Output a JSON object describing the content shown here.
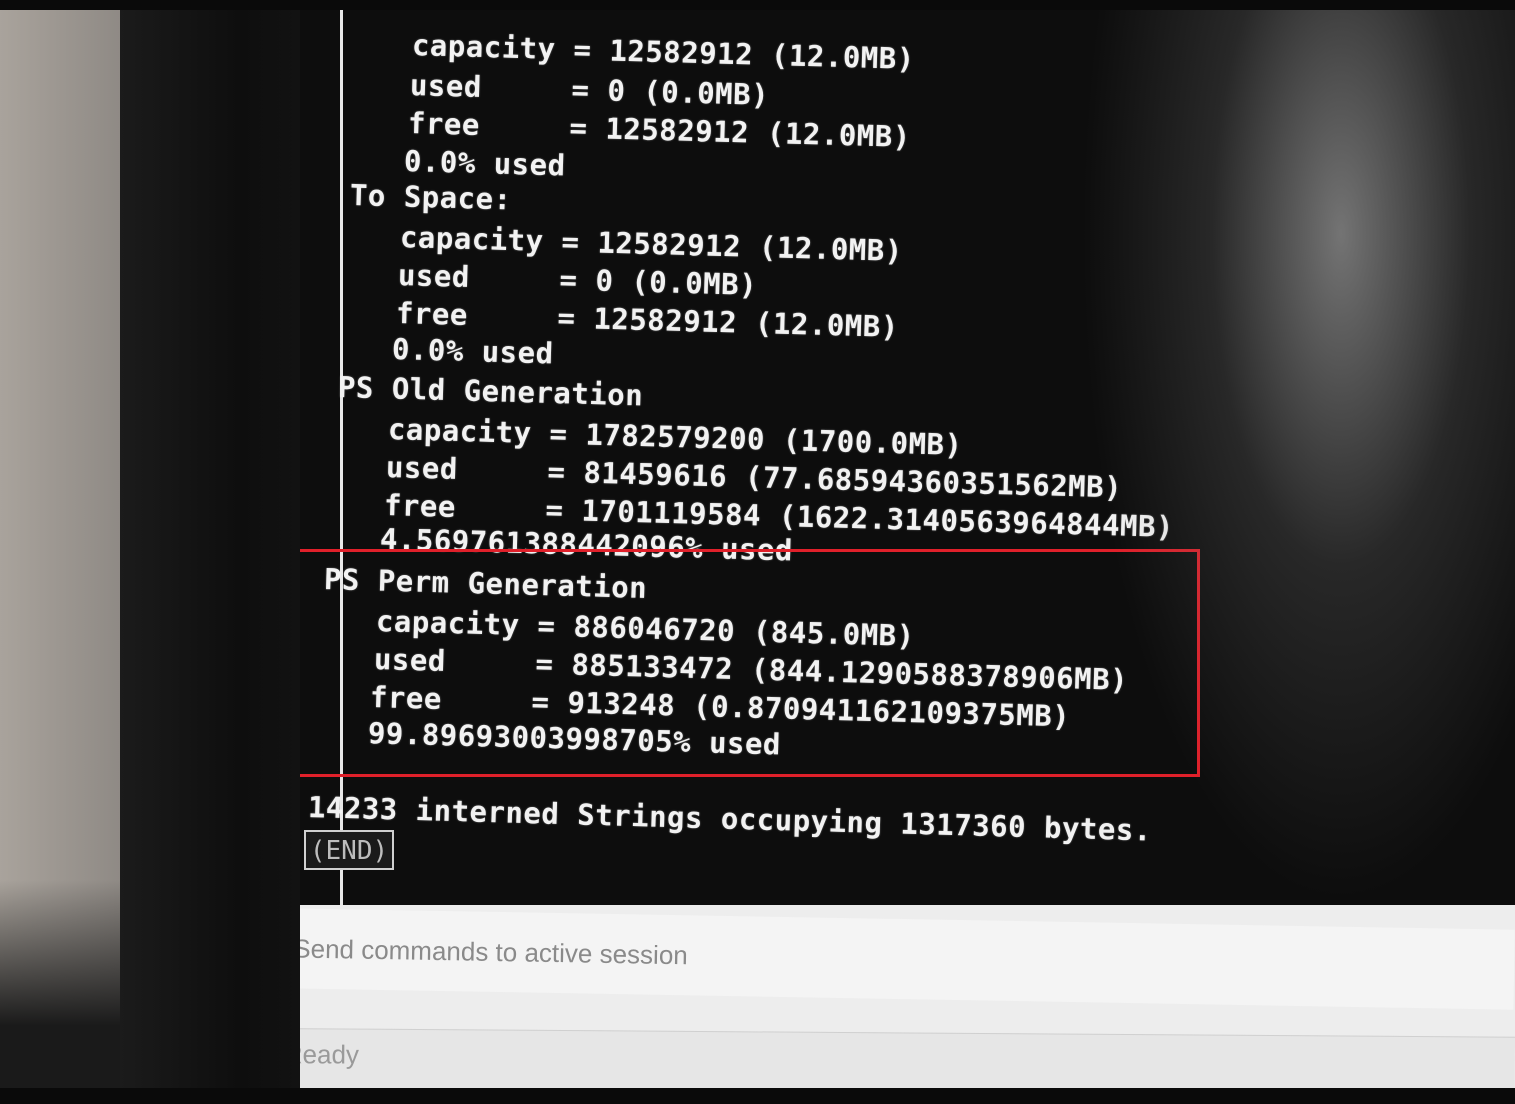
{
  "terminal": {
    "lines": [
      "capacity = 12582912 (12.0MB)",
      "used     = 0 (0.0MB)",
      "free     = 12582912 (12.0MB)",
      "0.0% used",
      "To Space:",
      "capacity = 12582912 (12.0MB)",
      "used     = 0 (0.0MB)",
      "free     = 12582912 (12.0MB)",
      "0.0% used",
      "PS Old Generation",
      "capacity = 1782579200 (1700.0MB)",
      "used     = 81459616 (77.68594360351562MB)",
      "free     = 1701119584 (1622.3140563964844MB)",
      "4.569761388442096% used",
      "PS Perm Generation",
      "capacity = 886046720 (845.0MB)",
      "used     = 885133472 (844.1290588378906MB)",
      "free     = 913248 (0.870941162109375MB)",
      "99.89693003998705% used",
      "14233 interned Strings occupying 1317360 bytes."
    ],
    "end_marker": "(END)"
  },
  "command_input": {
    "placeholder": "Send commands to active session",
    "value": ""
  },
  "status_bar": {
    "text": "Ready"
  },
  "colors": {
    "terminal_bg": "#0d0d0d",
    "terminal_text": "#f2f2f2",
    "highlight_border": "#e0202a"
  }
}
